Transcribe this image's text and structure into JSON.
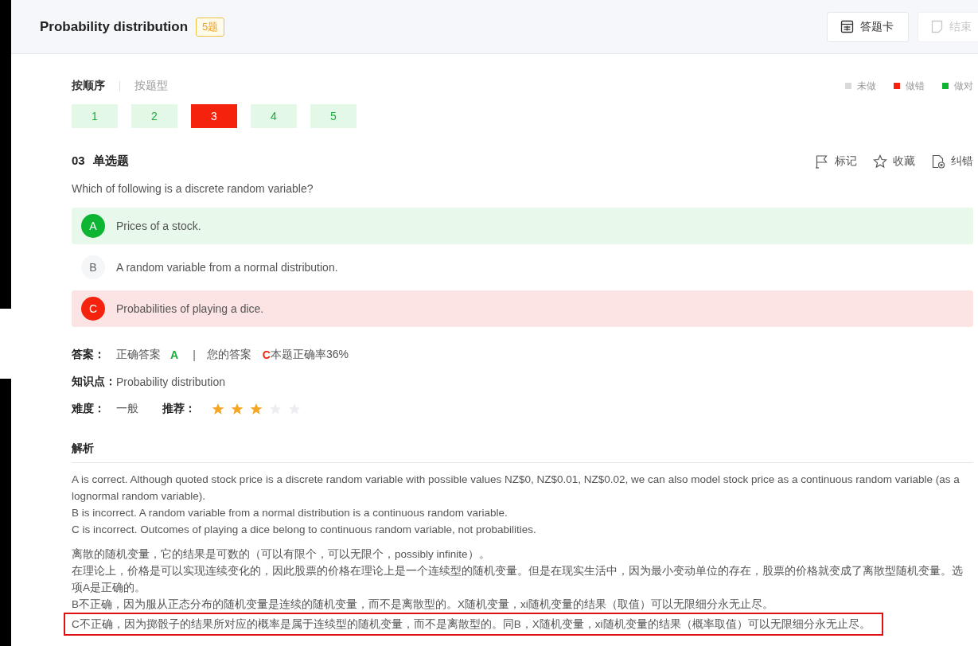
{
  "header": {
    "title": "Probability distribution",
    "count_badge": "5题",
    "buttons": [
      {
        "label": "答题卡",
        "kind": "card",
        "disabled": false
      },
      {
        "label": "结束",
        "kind": "finish",
        "disabled": true
      }
    ]
  },
  "sort_tabs": [
    {
      "label": "按顺序",
      "selected": true
    },
    {
      "label": "按题型",
      "selected": false
    }
  ],
  "legend": [
    {
      "label": "未做",
      "color": "#d9d9d9"
    },
    {
      "label": "做错",
      "color": "#f5220d"
    },
    {
      "label": "做对",
      "color": "#0db533"
    }
  ],
  "question_nav": [
    {
      "number": "1",
      "kind": "correct"
    },
    {
      "number": "2",
      "kind": "correct"
    },
    {
      "number": "3",
      "kind": "wrong"
    },
    {
      "number": "4",
      "kind": "correct"
    },
    {
      "number": "5",
      "kind": "correct"
    }
  ],
  "question": {
    "number": "03",
    "type": "单选题",
    "text": "Which of following is a discrete random variable?",
    "actions": [
      {
        "label": "标记",
        "kind": "flag"
      },
      {
        "label": "收藏",
        "kind": "star"
      },
      {
        "label": "纠错",
        "kind": "report"
      }
    ],
    "options": [
      {
        "letter": "A",
        "text": "Prices of a stock.",
        "kind": "correct"
      },
      {
        "letter": "B",
        "text": "A random variable from a normal distribution.",
        "kind": "plain"
      },
      {
        "letter": "C",
        "text": "Probabilities of playing a dice.",
        "kind": "wrong"
      }
    ]
  },
  "answer": {
    "label": "答案：",
    "correct_label": "正确答案",
    "correct": "A",
    "separator": "|",
    "your_label": "您的答案",
    "yours": "C",
    "rate": "本题正确率36%"
  },
  "knowledge": {
    "label": "知识点：",
    "value": "Probability distribution"
  },
  "difficulty": {
    "label": "难度：",
    "value": "一般",
    "recommend_label": "推荐：",
    "stars": 3
  },
  "analysis": {
    "title": "解析",
    "groups": [
      {
        "lines": [
          {
            "text": "A is correct. Although quoted stock price is a discrete random variable with possible values NZ$0, NZ$0.01, NZ$0.02, we can also model stock price as a continuous random variable (as a lognormal random variable).",
            "highlighted": false
          },
          {
            "text": "B is incorrect. A random variable from a normal distribution is a continuous random variable.",
            "highlighted": false
          },
          {
            "text": "C is incorrect. Outcomes of playing a dice belong to continuous random variable, not probabilities.",
            "highlighted": false
          }
        ]
      },
      {
        "lines": [
          {
            "text": "离散的随机变量，它的结果是可数的（可以有限个，可以无限个，possibly infinite）。",
            "highlighted": false
          },
          {
            "text": "在理论上，价格是可以实现连续变化的，因此股票的价格在理论上是一个连续型的随机变量。但是在现实生活中，因为最小变动单位的存在，股票的价格就变成了离散型随机变量。选项A是正确的。",
            "highlighted": false
          },
          {
            "text": "B不正确，因为服从正态分布的随机变量是连续的随机变量，而不是离散型的。X随机变量，xi随机变量的结果（取值）可以无限细分永无止尽。",
            "highlighted": false
          },
          {
            "text": "C不正确，因为掷骰子的结果所对应的概率是属于连续型的随机变量，而不是离散型的。同B，X随机变量，xi随机变量的结果（概率取值）可以无限细分永无止尽。",
            "highlighted": true
          }
        ]
      }
    ]
  }
}
